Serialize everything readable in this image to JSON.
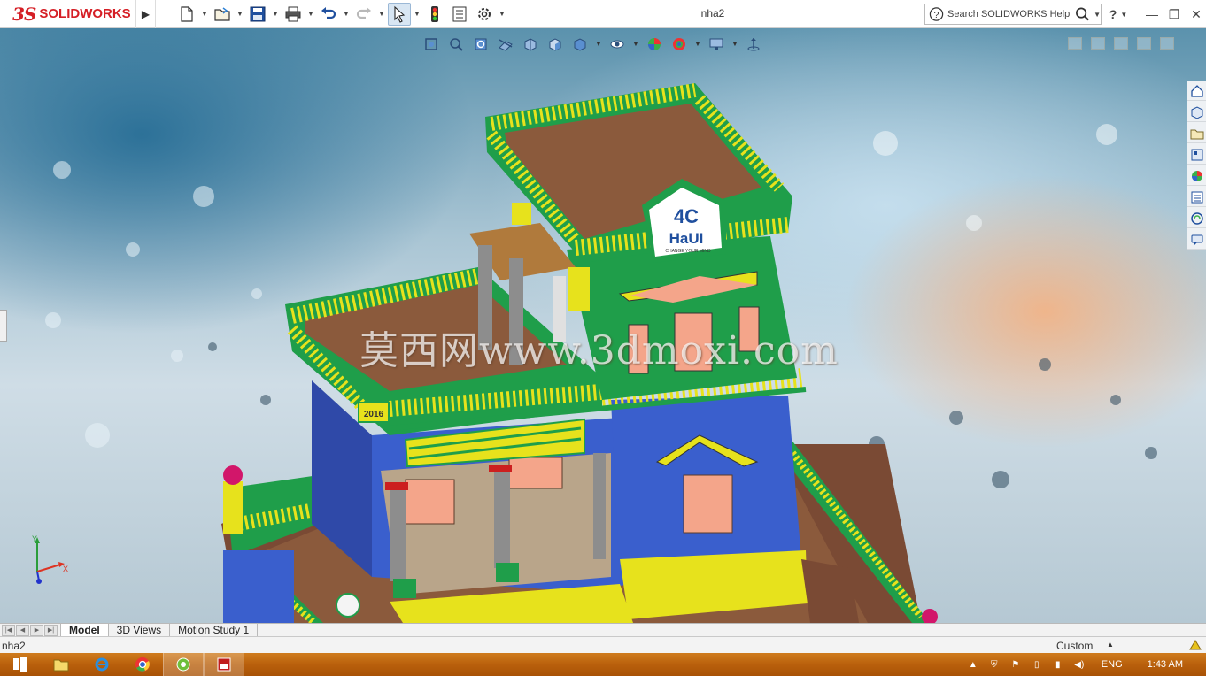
{
  "app": {
    "logo_prefix": "3S",
    "logo_text": "SOLIDWORKS",
    "doc_title": "nha2",
    "search_placeholder": "Search SOLIDWORKS Help",
    "help_glyph": "?"
  },
  "icons": {
    "quick_access": [
      "new-document-icon",
      "open-folder-icon",
      "save-icon",
      "print-icon",
      "undo-icon",
      "redo-icon",
      "select-cursor-icon",
      "rebuild-traffic-light-icon",
      "file-properties-icon",
      "options-gear-icon"
    ],
    "heads_up": [
      "zoom-to-fit-icon",
      "zoom-to-area-icon",
      "previous-view-icon",
      "section-view-icon",
      "dynamic-annotation-icon",
      "view-orientation-icon",
      "display-style-icon",
      "hide-show-items-icon",
      "edit-appearance-icon",
      "apply-scene-icon",
      "view-settings-icon",
      "rotate-view-icon"
    ],
    "task_pane": [
      "solidworks-resources-icon",
      "design-library-icon",
      "file-explorer-icon",
      "view-palette-icon",
      "appearances-scenes-icon",
      "custom-properties-icon",
      "solidworks-forum-icon",
      "chat-icon"
    ]
  },
  "viewport": {
    "watermark": "莫西网www.3dmoxi.com",
    "model_badge_year": "2016",
    "model_sign_top": "4C",
    "model_sign_main": "HaUI",
    "model_sign_sub": "CHANGE YOUR MIND",
    "triad_x": "X",
    "triad_y": "Y"
  },
  "tabs": {
    "items": [
      {
        "label": "Model",
        "active": true
      },
      {
        "label": "3D Views",
        "active": false
      },
      {
        "label": "Motion Study 1",
        "active": false
      }
    ]
  },
  "status": {
    "doc_name": "nha2",
    "units": "Custom"
  },
  "taskbar": {
    "lang": "ENG",
    "time": "1:43 AM",
    "apps": [
      "windows-start-icon",
      "file-explorer-icon",
      "internet-explorer-icon",
      "chrome-icon",
      "greenshot-icon",
      "solidworks-2016-icon"
    ]
  },
  "colors": {
    "brand_red": "#d51f26",
    "taskbar_orange": "#b9600c",
    "house_blue": "#3a5fcd",
    "house_green": "#1f9e4a",
    "house_yellow": "#e7e21c"
  }
}
